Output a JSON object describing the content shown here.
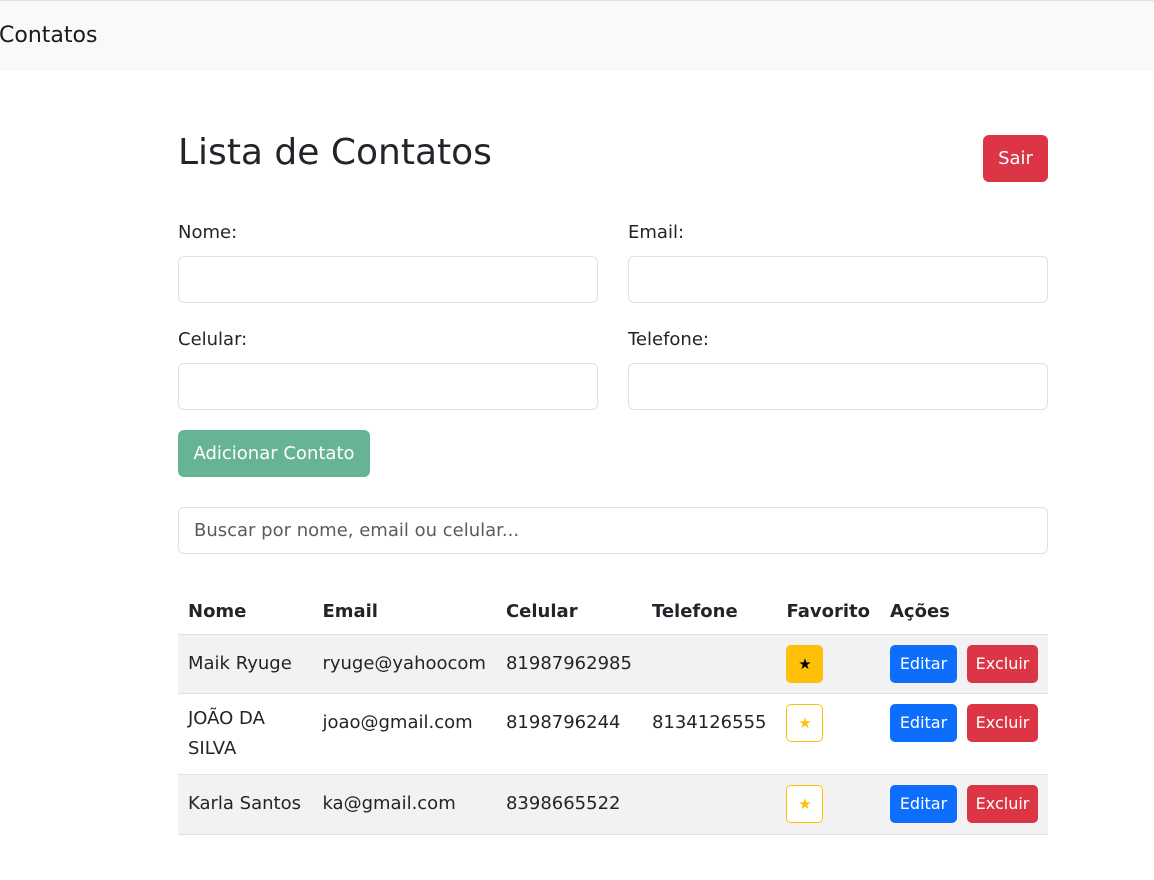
{
  "navbar": {
    "brand": "Contatos"
  },
  "page": {
    "title": "Lista de Contatos",
    "logout_label": "Sair"
  },
  "form": {
    "nome_label": "Nome:",
    "email_label": "Email:",
    "celular_label": "Celular:",
    "telefone_label": "Telefone:",
    "nome_value": "",
    "email_value": "",
    "celular_value": "",
    "telefone_value": "",
    "add_label": "Adicionar Contato"
  },
  "search": {
    "placeholder": "Buscar por nome, email ou celular..."
  },
  "table": {
    "headers": [
      "Nome",
      "Email",
      "Celular",
      "Telefone",
      "Favorito",
      "Ações"
    ],
    "edit_label": "Editar",
    "delete_label": "Excluir",
    "favorite_icon": "★",
    "rows": [
      {
        "nome": "Maik Ryuge",
        "email": "ryuge@yahoocom",
        "celular": "81987962985",
        "telefone": "",
        "favorito": true
      },
      {
        "nome": "JOÃO DA SILVA",
        "email": "joao@gmail.com",
        "celular": "8198796244",
        "telefone": "8134126555",
        "favorito": false
      },
      {
        "nome": "Karla Santos",
        "email": "ka@gmail.com",
        "celular": "8398665522",
        "telefone": "",
        "favorito": false
      }
    ]
  },
  "colors": {
    "danger": "#dc3545",
    "primary": "#0d6efd",
    "success_disabled": "#66b396",
    "warning": "#ffc107"
  }
}
